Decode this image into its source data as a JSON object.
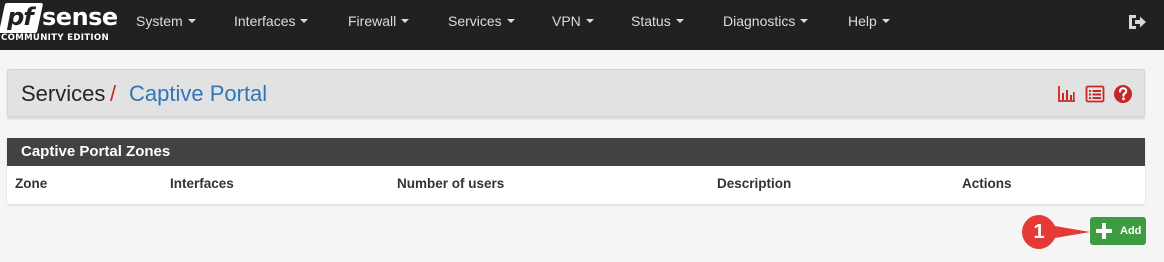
{
  "navbar": {
    "logo": {
      "brand_prefix": "pf",
      "brand_suffix": "sense",
      "edition": "COMMUNITY EDITION"
    },
    "menu": [
      {
        "label": "System"
      },
      {
        "label": "Interfaces"
      },
      {
        "label": "Firewall"
      },
      {
        "label": "Services"
      },
      {
        "label": "VPN"
      },
      {
        "label": "Status"
      },
      {
        "label": "Diagnostics"
      },
      {
        "label": "Help"
      }
    ],
    "logout_icon": "sign-out-icon"
  },
  "header": {
    "breadcrumb_section": "Services",
    "breadcrumb_separator": "/",
    "breadcrumb_page": "Captive Portal",
    "icons": [
      "bar-chart-icon",
      "list-icon",
      "help-icon"
    ],
    "icon_color": "#c62828"
  },
  "panel": {
    "title": "Captive Portal Zones",
    "columns": [
      "Zone",
      "Interfaces",
      "Number of users",
      "Description",
      "Actions"
    ],
    "rows": []
  },
  "actions": {
    "add_label": "Add",
    "add_color": "#3f9b42"
  },
  "annotation": {
    "number": "1",
    "color": "#e53935"
  }
}
